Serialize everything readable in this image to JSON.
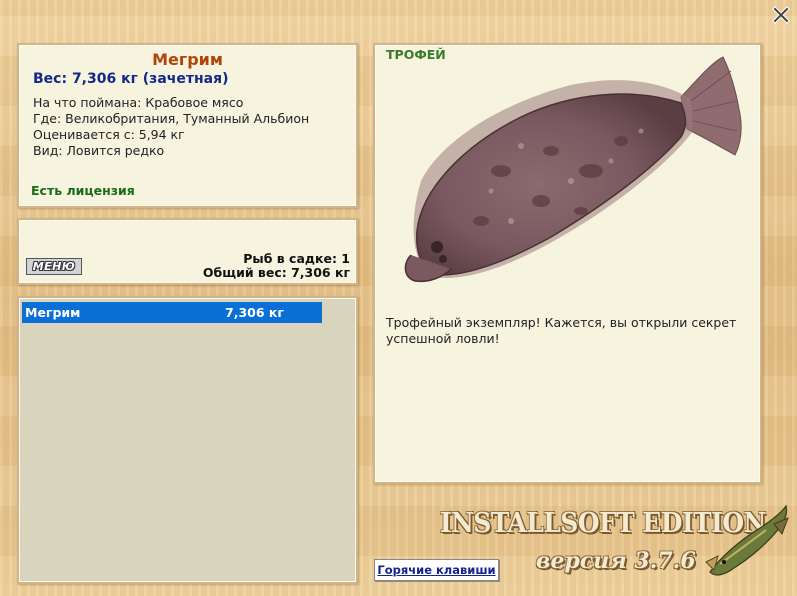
{
  "fish": {
    "name": "Мегрим",
    "weight": "Вес: 7,306 кг (зачетная)",
    "caught_on": "На что поймана: Крабовое мясо",
    "location": "Где: Великобритания, Туманный Альбион",
    "rated_from": "Оценивается с: 5,94 кг",
    "kind": "Вид: Ловится редко",
    "license": "Есть лицензия"
  },
  "counter": {
    "menu_label": "МЕНЮ",
    "fish_count": "Рыб в садке: 1",
    "total_weight": "Общий вес: 7,306 кг"
  },
  "catch_list": [
    {
      "name": "Мегрим",
      "weight": "7,306 кг"
    }
  ],
  "trophy": {
    "label": "ТРОФЕЙ",
    "description": "Трофейный экземпляр! Кажется, вы открыли секрет успешной ловли!"
  },
  "brand": {
    "title": "INSTALLSOFT EDITION",
    "version": "версия 3.7.6"
  },
  "hotkeys_label": "Горячие клавиши",
  "icons": {
    "close": "close-icon",
    "fish": "flatfish-image",
    "logo": "pike-icon"
  },
  "colors": {
    "name": "#b0450a",
    "weight": "#14288a",
    "license": "#1a6a1a",
    "trophy": "#3a7a2a",
    "selection": "#0a6fd6"
  }
}
